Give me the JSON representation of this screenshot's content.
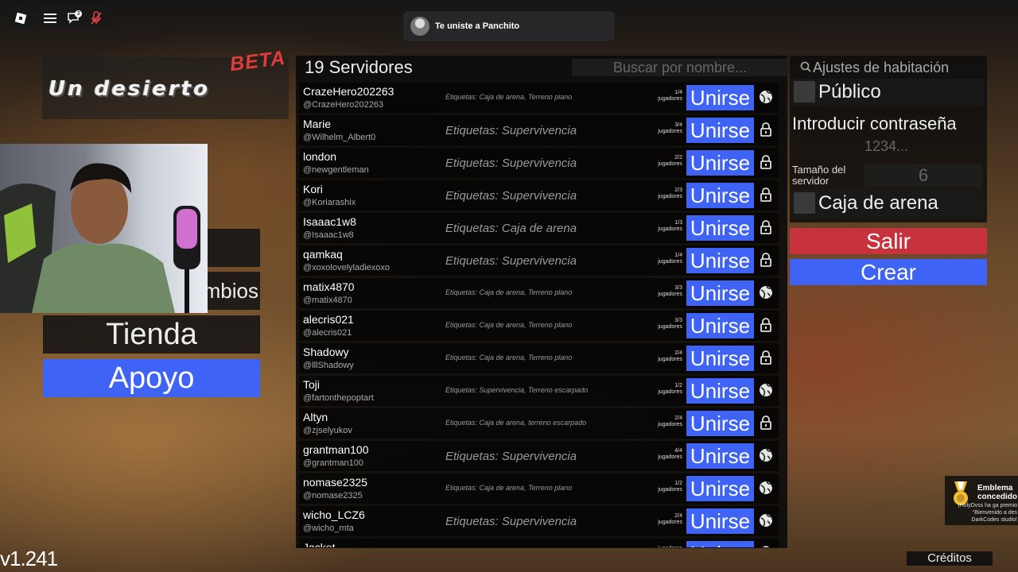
{
  "notification": {
    "text": "Te uniste a Panchito"
  },
  "chat_badge_count": "3",
  "logo": {
    "beta": "BETA",
    "title": "Un desierto"
  },
  "left_menu": {
    "partial_label": "mbios",
    "shop": "Tienda",
    "support": "Apoyo"
  },
  "version": "v1.241",
  "servers": {
    "title": "19 Servidores",
    "search_placeholder": "Buscar por nombre...",
    "join_label": "Unirse",
    "players_label": "jugadores",
    "rows": [
      {
        "name": "CrazeHero202263",
        "handle": "@CrazeHero202263",
        "tags": "Etiquetas: Caja de arena, Terreno plano",
        "small": true,
        "count": "1/4",
        "icon": "globe"
      },
      {
        "name": "Marie",
        "handle": "@Wilhelm_Albert0",
        "tags": "Etiquetas: Supervivencia",
        "small": false,
        "count": "3/4",
        "icon": "lock"
      },
      {
        "name": "london",
        "handle": "@newgentleman",
        "tags": "Etiquetas: Supervivencia",
        "small": false,
        "count": "2/2",
        "icon": "lock"
      },
      {
        "name": "Kori",
        "handle": "@Koriarashix",
        "tags": "Etiquetas: Supervivencia",
        "small": false,
        "count": "2/3",
        "icon": "lock"
      },
      {
        "name": "Isaaac1w8",
        "handle": "@Isaaac1w8",
        "tags": "Etiquetas: Caja de arena",
        "small": false,
        "count": "1/3",
        "icon": "lock"
      },
      {
        "name": "qamkaq",
        "handle": "@xoxolovelyladiexoxo",
        "tags": "Etiquetas: Supervivencia",
        "small": false,
        "count": "1/4",
        "icon": "lock"
      },
      {
        "name": "matix4870",
        "handle": "@matix4870",
        "tags": "Etiquetas: Caja de arena, Terreno plano",
        "small": true,
        "count": "3/3",
        "icon": "globe"
      },
      {
        "name": "alecris021",
        "handle": "@alecris021",
        "tags": "Etiquetas: Caja de arena, Terreno plano",
        "small": true,
        "count": "3/3",
        "icon": "lock"
      },
      {
        "name": "Shadowy",
        "handle": "@lllShadowy",
        "tags": "Etiquetas: Caja de arena, Terreno plano",
        "small": true,
        "count": "2/4",
        "icon": "lock"
      },
      {
        "name": "Toji",
        "handle": "@fartonthepoptart",
        "tags": "Etiquetas: Supervivencia, Terreno escarpado",
        "small": true,
        "count": "1/2",
        "icon": "globe"
      },
      {
        "name": "Altyn",
        "handle": "@zjselyukov",
        "tags": "Etiquetas: Caja de arena, terreno escarpado",
        "small": true,
        "count": "2/4",
        "icon": "lock"
      },
      {
        "name": "grantman100",
        "handle": "@grantman100",
        "tags": "Etiquetas: Supervivencia",
        "small": false,
        "count": "4/4",
        "icon": "globe"
      },
      {
        "name": "nomase2325",
        "handle": "@nomase2325",
        "tags": "Etiquetas: Caja de arena, Terreno plano",
        "small": true,
        "count": "1/2",
        "icon": "globe"
      },
      {
        "name": "wicho_LCZ6",
        "handle": "@wicho_mta",
        "tags": "Etiquetas: Supervivencia",
        "small": false,
        "count": "2/4",
        "icon": "globe"
      },
      {
        "name": "Jacket",
        "handle": "",
        "tags": "",
        "small": false,
        "count": "",
        "icon": "lock"
      }
    ]
  },
  "room_settings": {
    "title": "Ajustes de habitación",
    "public_label": "Público",
    "password_label": "Introducir contraseña",
    "password_placeholder": "1234...",
    "size_label": "Tamaño del servidor",
    "size_value": "6",
    "sandbox_label": "Caja de arena",
    "exit_label": "Salir",
    "create_label": "Crear"
  },
  "credits": "Créditos",
  "badge": {
    "title": "Emblema concedido",
    "desc": "¡HolyDvss ha ga premio \"Bienvenido a des DarkCodes studio!"
  },
  "colors": {
    "join_blue": "#3f63f5",
    "exit_red": "#c8323c",
    "beta_red": "#e23b3b"
  }
}
